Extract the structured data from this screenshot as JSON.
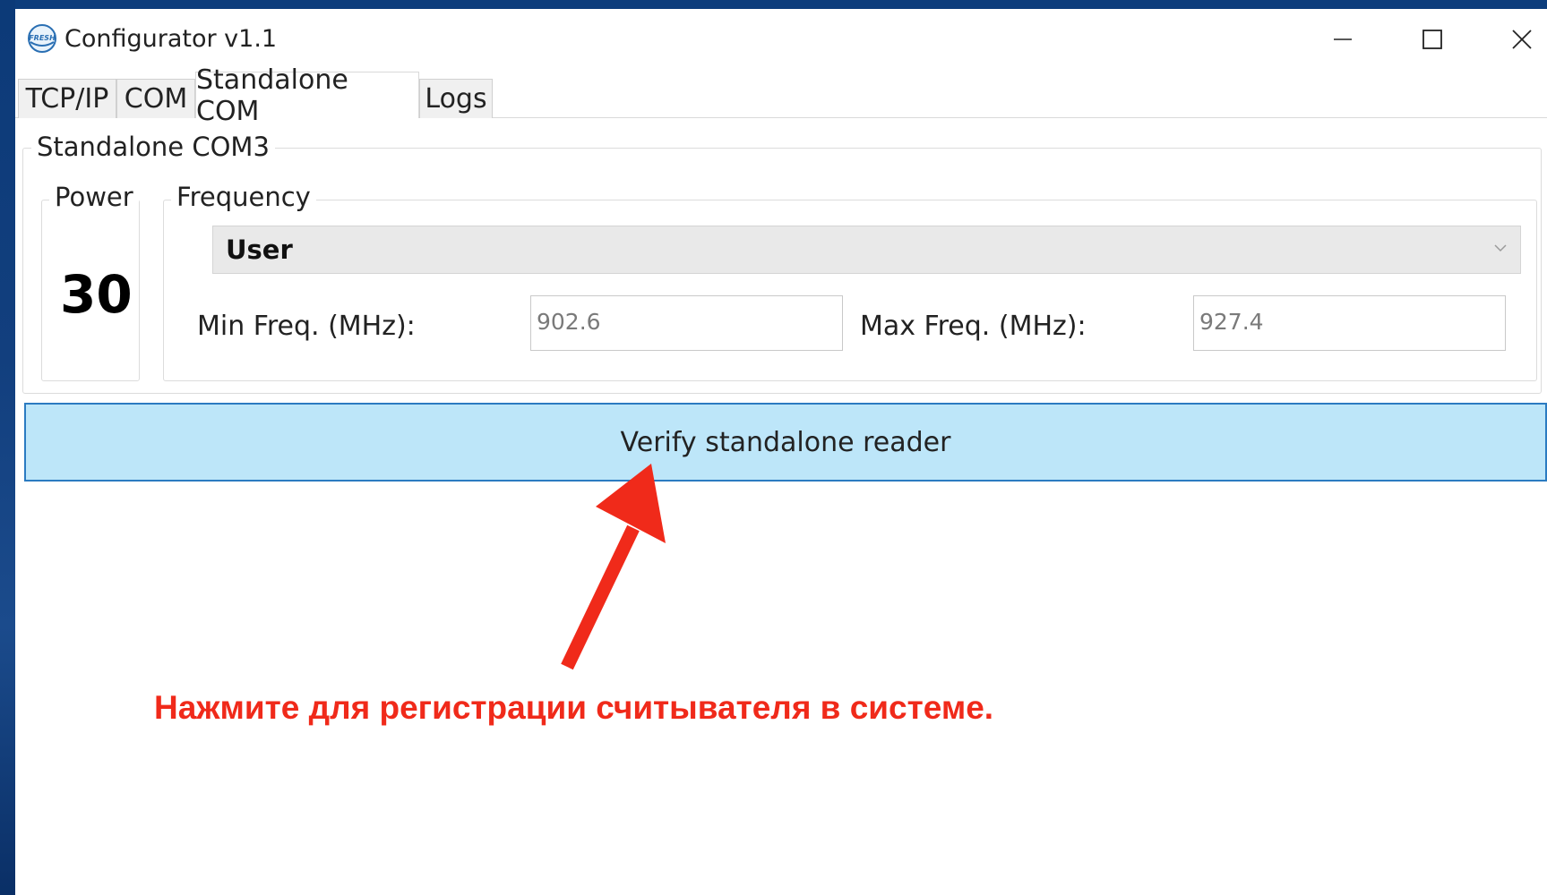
{
  "window": {
    "title": "Configurator v1.1",
    "icon": "fresh-logo-icon",
    "logo_text": "FRESH",
    "controls": [
      "minimize-icon",
      "maximize-icon",
      "close-icon"
    ]
  },
  "tabs": [
    {
      "label": "TCP/IP",
      "active": false
    },
    {
      "label": "COM",
      "active": false
    },
    {
      "label": "Standalone COM",
      "active": true
    },
    {
      "label": "Logs",
      "active": false
    }
  ],
  "standalone": {
    "group_title": "Standalone COM3",
    "power": {
      "label": "Power",
      "value": "30"
    },
    "frequency": {
      "label": "Frequency",
      "selected": "User",
      "min_label": "Min Freq. (MHz):",
      "min_value": "902.6",
      "max_label": "Max Freq. (MHz):",
      "max_value": "927.4"
    },
    "verify_button": "Verify standalone reader"
  },
  "annotation": {
    "text": "Нажмите для регистрации считывателя в системе.",
    "color": "#f02a1a"
  },
  "colors": {
    "button_bg": "#bde6f9",
    "button_border": "#2b7bc1",
    "accent_red": "#f02a1a"
  }
}
